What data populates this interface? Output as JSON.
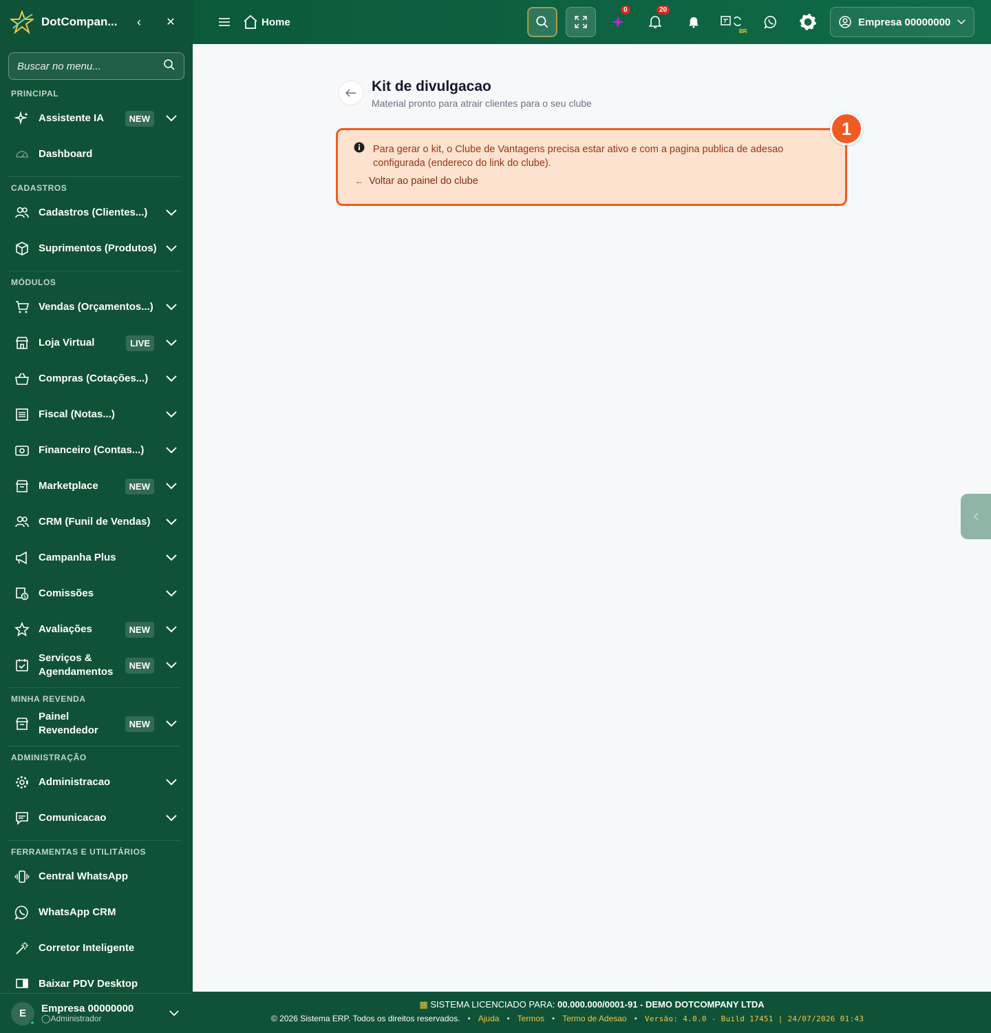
{
  "sidebar": {
    "brand": "DotCompan...",
    "search_placeholder": "Buscar no menu...",
    "sections": {
      "principal": "PRINCIPAL",
      "cadastros": "CADASTROS",
      "modulos": "MÓDULOS",
      "revenda": "MINHA REVENDA",
      "administracao": "ADMINISTRAÇÃO",
      "ferramentas": "FERRAMENTAS E UTILITÁRIOS"
    },
    "items": {
      "assistente": {
        "label": "Assistente IA",
        "badge": "NEW"
      },
      "dashboard": {
        "label": "Dashboard"
      },
      "cadastros": {
        "label": "Cadastros (Clientes...)"
      },
      "suprimentos": {
        "label": "Suprimentos (Produtos)"
      },
      "vendas": {
        "label": "Vendas (Orçamentos...)"
      },
      "loja": {
        "label": "Loja Virtual",
        "badge": "LIVE"
      },
      "compras": {
        "label": "Compras (Cotações...)"
      },
      "fiscal": {
        "label": "Fiscal (Notas...)"
      },
      "financeiro": {
        "label": "Financeiro (Contas...)"
      },
      "marketplace": {
        "label": "Marketplace",
        "badge": "NEW"
      },
      "crm": {
        "label": "CRM (Funil de Vendas)"
      },
      "campanha": {
        "label": "Campanha Plus"
      },
      "comissoes": {
        "label": "Comissões"
      },
      "avaliacoes": {
        "label": "Avaliações",
        "badge": "NEW"
      },
      "servicos": {
        "label": "Serviços & Agendamentos",
        "badge": "NEW"
      },
      "painel": {
        "label": "Painel Revendedor",
        "badge": "NEW"
      },
      "administracao": {
        "label": "Administracao"
      },
      "comunicacao": {
        "label": "Comunicacao"
      },
      "central_whatsapp": {
        "label": "Central WhatsApp"
      },
      "whatsapp_crm": {
        "label": "WhatsApp CRM"
      },
      "corretor": {
        "label": "Corretor Inteligente"
      },
      "pdv": {
        "label": "Baixar PDV Desktop"
      }
    },
    "footer": {
      "initial": "E",
      "name": "Empresa 00000000",
      "role": "Administrador"
    }
  },
  "topbar": {
    "home_label": "Home",
    "ai_count": "0",
    "notifications_count": "20",
    "lang_code": "BR",
    "user_label": "Empresa 00000000"
  },
  "main": {
    "title": "Kit de divulgacao",
    "subtitle": "Material pronto para atrair clientes para o seu clube",
    "alert_text": "Para gerar o kit, o Clube de Vantagens precisa estar ativo e com a pagina publica de adesao configurada (endereco do link do clube).",
    "alert_link": "Voltar ao painel do clube",
    "marker": "1"
  },
  "footer": {
    "license_prefix": "SISTEMA LICENCIADO PARA:",
    "license_value": "00.000.000/0001-91 - DEMO DOTCOMPANY LTDA",
    "copyright": "© 2026 Sistema ERP. Todos os direitos reservados.",
    "links": [
      "Ajuda",
      "Termos",
      "Termo de Adesao"
    ],
    "version": "Versão: 4.0.0 - Build 17451 | 24/07/2026 01:43"
  },
  "colors": {
    "sidebar": "#0f5238",
    "accent": "#f15a22",
    "alert_bg": "#fde3cf",
    "link_yellow": "#f5c542"
  }
}
